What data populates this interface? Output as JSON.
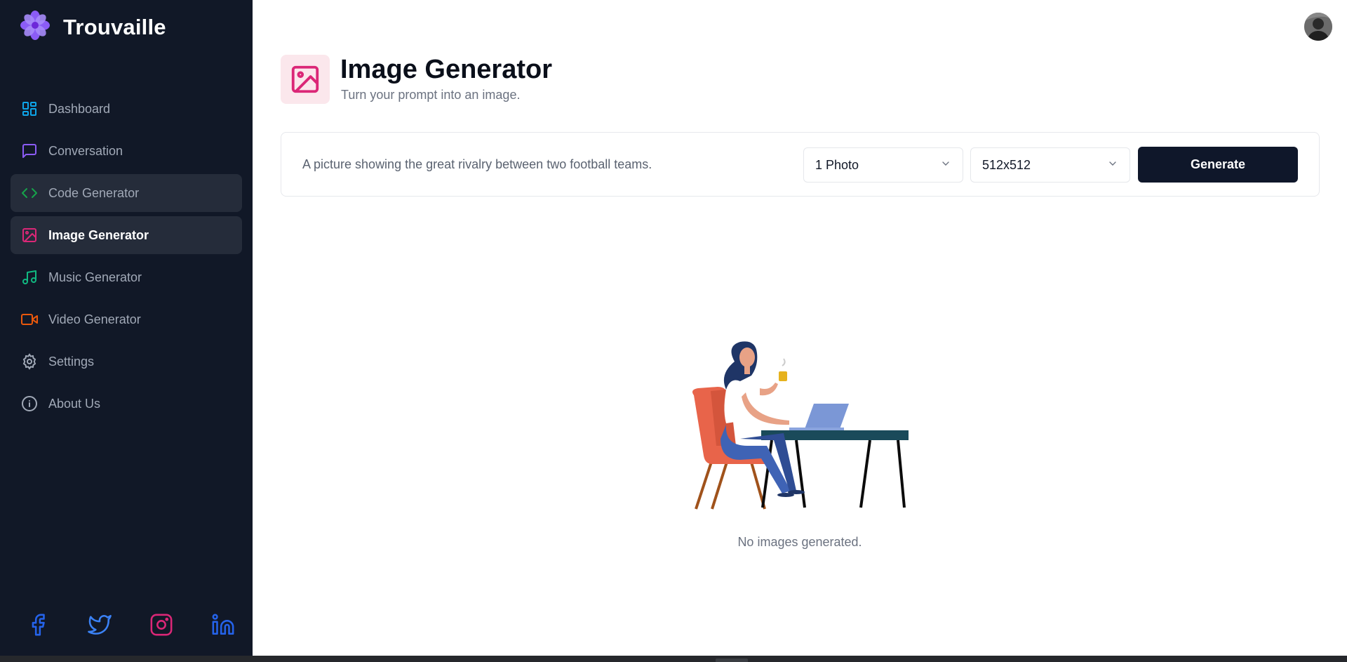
{
  "app": {
    "name": "Trouvaille"
  },
  "sidebar": {
    "items": [
      {
        "label": "Dashboard",
        "icon": "dashboard-icon",
        "color": "#0ea5e9"
      },
      {
        "label": "Conversation",
        "icon": "message-icon",
        "color": "#8b5cf6"
      },
      {
        "label": "Code Generator",
        "icon": "code-icon",
        "color": "#16a34a"
      },
      {
        "label": "Image Generator",
        "icon": "image-icon",
        "color": "#db2777"
      },
      {
        "label": "Music Generator",
        "icon": "music-icon",
        "color": "#10b981"
      },
      {
        "label": "Video Generator",
        "icon": "video-icon",
        "color": "#ea580c"
      },
      {
        "label": "Settings",
        "icon": "gear-icon",
        "color": "#a1a9b7"
      },
      {
        "label": "About Us",
        "icon": "info-icon",
        "color": "#a1a9b7"
      }
    ],
    "active": "Image Generator",
    "hovered": "Code Generator",
    "socials": [
      "facebook-icon",
      "twitter-icon",
      "instagram-icon",
      "linkedin-icon"
    ]
  },
  "header": {
    "title": "Image Generator",
    "subtitle": "Turn your prompt into an image.",
    "accent": "#db2777"
  },
  "form": {
    "prompt_value": "A picture showing the great rivalry between two football teams.",
    "amount_selected": "1 Photo",
    "resolution_selected": "512x512",
    "generate_label": "Generate"
  },
  "empty_state": {
    "message": "No images generated."
  },
  "colors": {
    "sidebar_bg": "#111827",
    "button_bg": "#0f172a"
  }
}
